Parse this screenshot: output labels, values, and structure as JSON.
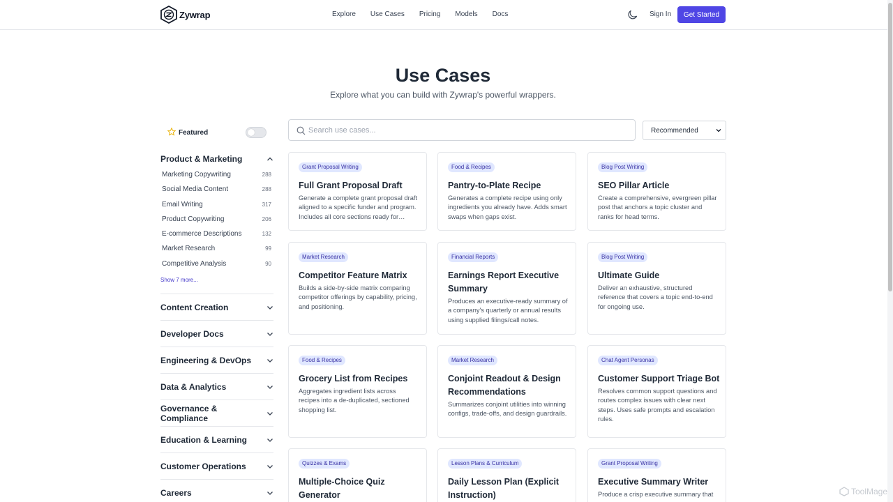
{
  "header": {
    "brand": "Zywrap",
    "nav": [
      "Explore",
      "Use Cases",
      "Pricing",
      "Models",
      "Docs"
    ],
    "sign_in": "Sign In",
    "cta": "Get Started"
  },
  "hero": {
    "title": "Use Cases",
    "subtitle": "Explore what you can build with Zywrap's powerful wrappers."
  },
  "sidebar": {
    "featured_label": "Featured",
    "featured_toggle_on": false,
    "open_group": {
      "title": "Product & Marketing",
      "items": [
        {
          "label": "Marketing Copywriting",
          "count": "288"
        },
        {
          "label": "Social Media Content",
          "count": "288"
        },
        {
          "label": "Email Writing",
          "count": "317"
        },
        {
          "label": "Product Copywriting",
          "count": "206"
        },
        {
          "label": "E-commerce Descriptions",
          "count": "132"
        },
        {
          "label": "Market Research",
          "count": "99"
        },
        {
          "label": "Competitive Analysis",
          "count": "90"
        }
      ],
      "show_more": "Show 7 more..."
    },
    "groups": [
      "Content Creation",
      "Developer Docs",
      "Engineering & DevOps",
      "Data & Analytics",
      "Governance & Compliance",
      "Education & Learning",
      "Customer Operations",
      "Careers"
    ]
  },
  "search": {
    "placeholder": "Search use cases...",
    "value": ""
  },
  "sort": {
    "selected": "Recommended"
  },
  "cards": [
    {
      "badge": "Grant Proposal Writing",
      "title": "Full Grant Proposal Draft",
      "desc": "Generate a complete grant proposal draft aligned to a specific funder and program. Includes all core sections ready for review and submission."
    },
    {
      "badge": "Food & Recipes",
      "title": "Pantry-to-Plate Recipe",
      "desc": "Generates a complete recipe using only ingredients you already have. Adds smart swaps when gaps exist."
    },
    {
      "badge": "Blog Post Writing",
      "title": "SEO Pillar Article",
      "desc": "Create a comprehensive, evergreen pillar post that anchors a topic cluster and ranks for head terms."
    },
    {
      "badge": "Market Research",
      "title": "Competitor Feature Matrix",
      "desc": "Builds a side-by-side matrix comparing competitor offerings by capability, pricing, and positioning."
    },
    {
      "badge": "Financial Reports",
      "title": "Earnings Report Executive Summary",
      "desc": "Produces an executive-ready summary of a company's quarterly or annual results using supplied filings/call notes."
    },
    {
      "badge": "Blog Post Writing",
      "title": "Ultimate Guide",
      "desc": "Deliver an exhaustive, structured reference that covers a topic end-to-end for ongoing use."
    },
    {
      "badge": "Food & Recipes",
      "title": "Grocery List from Recipes",
      "desc": "Aggregates ingredient lists across recipes into a de-duplicated, sectioned shopping list."
    },
    {
      "badge": "Market Research",
      "title": "Conjoint Readout & Design Recommendations",
      "desc": "Summarizes conjoint utilities into winning configs, trade-offs, and design guardrails."
    },
    {
      "badge": "Chat Agent Personas",
      "title": "Customer Support Triage Bot",
      "desc": "Resolves common support questions and routes complex issues with clear next steps. Uses safe prompts and escalation rules."
    },
    {
      "badge": "Quizzes & Exams",
      "title": "Multiple-Choice Quiz Generator",
      "desc": ""
    },
    {
      "badge": "Lesson Plans & Curriculum",
      "title": "Daily Lesson Plan (Explicit Instruction)",
      "desc": ""
    },
    {
      "badge": "Grant Proposal Writing",
      "title": "Executive Summary Writer",
      "desc": "Produce a crisp executive summary that"
    }
  ],
  "watermark": "ToolMage",
  "colors": {
    "primary": "#4f46e5",
    "badge_bg": "#e0e7ff",
    "badge_text": "#3730a3",
    "text_dark": "#1f2937",
    "text_muted": "#4b5563",
    "border": "#e5e7eb"
  }
}
